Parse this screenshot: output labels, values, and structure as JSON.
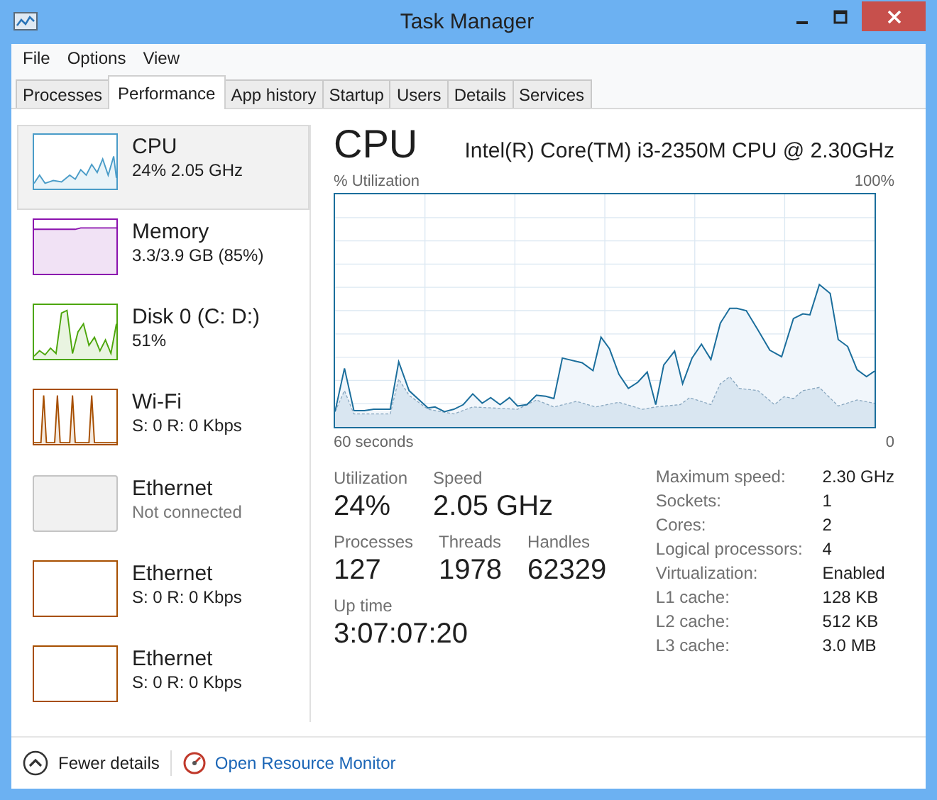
{
  "window": {
    "title": "Task Manager"
  },
  "menu": [
    "File",
    "Options",
    "View"
  ],
  "tabs": [
    {
      "label": "Processes",
      "selected": false
    },
    {
      "label": "Performance",
      "selected": true
    },
    {
      "label": "App history",
      "selected": false
    },
    {
      "label": "Startup",
      "selected": false
    },
    {
      "label": "Users",
      "selected": false
    },
    {
      "label": "Details",
      "selected": false
    },
    {
      "label": "Services",
      "selected": false
    }
  ],
  "sidebar": {
    "items": [
      {
        "kind": "cpu",
        "name": "CPU",
        "detail": "24% 2.05 GHz",
        "color": "#4a9cc8",
        "selected": true,
        "disabled": false
      },
      {
        "kind": "memory",
        "name": "Memory",
        "detail": "3.3/3.9 GB (85%)",
        "color": "#8b12ae",
        "selected": false,
        "disabled": false
      },
      {
        "kind": "disk",
        "name": "Disk 0 (C: D:)",
        "detail": "51%",
        "color": "#4da60c",
        "selected": false,
        "disabled": false
      },
      {
        "kind": "wifi",
        "name": "Wi-Fi",
        "detail": "S: 0 R: 0 Kbps",
        "color": "#a74f01",
        "selected": false,
        "disabled": false
      },
      {
        "kind": "ethernet",
        "name": "Ethernet",
        "detail": "Not connected",
        "color": "#c4c4c4",
        "selected": false,
        "disabled": true
      },
      {
        "kind": "ethernet",
        "name": "Ethernet",
        "detail": "S: 0 R: 0 Kbps",
        "color": "#a74f01",
        "selected": false,
        "disabled": false
      },
      {
        "kind": "ethernet",
        "name": "Ethernet",
        "detail": "S: 0 R: 0 Kbps",
        "color": "#a74f01",
        "selected": false,
        "disabled": false
      }
    ]
  },
  "main": {
    "heading": "CPU",
    "model": "Intel(R) Core(TM) i3-2350M CPU @ 2.30GHz",
    "chart": {
      "ylabel": "% Utilization",
      "ymax": "100%",
      "xlabel": "60 seconds",
      "xmin": "0"
    },
    "stat_rows": [
      {
        "items": [
          {
            "label": "Utilization",
            "value": "24%"
          },
          {
            "label": "Speed",
            "value": "2.05 GHz"
          }
        ]
      },
      {
        "items": [
          {
            "label": "Processes",
            "value": "127"
          },
          {
            "label": "Threads",
            "value": "1978"
          },
          {
            "label": "Handles",
            "value": "62329"
          }
        ]
      },
      {
        "items": [
          {
            "label": "Up time",
            "value": "3:07:07:20"
          }
        ]
      }
    ],
    "specs": [
      {
        "label": "Maximum speed:",
        "value": "2.30 GHz"
      },
      {
        "label": "Sockets:",
        "value": "1"
      },
      {
        "label": "Cores:",
        "value": "2"
      },
      {
        "label": "Logical processors:",
        "value": "4"
      },
      {
        "label": "Virtualization:",
        "value": "Enabled"
      },
      {
        "label": "L1 cache:",
        "value": "128 KB"
      },
      {
        "label": "L2 cache:",
        "value": "512 KB"
      },
      {
        "label": "L3 cache:",
        "value": "3.0 MB"
      }
    ]
  },
  "footer": {
    "toggle": "Fewer details",
    "link": "Open Resource Monitor"
  }
}
